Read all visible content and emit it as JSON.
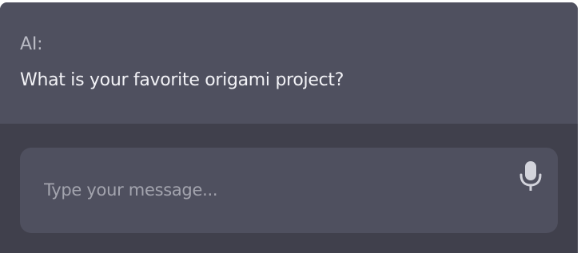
{
  "conversation": {
    "speaker_label": "AI:",
    "message": "What is your favorite origami project?"
  },
  "composer": {
    "placeholder": "Type your message...",
    "value": "",
    "mic_icon": "microphone-icon"
  },
  "colors": {
    "message_background": "#4f505f",
    "window_background": "#40404c",
    "input_background": "#4f505f",
    "text_primary": "#f2f2f6",
    "text_muted": "#b9bac4",
    "icon": "#d3d4dc"
  }
}
